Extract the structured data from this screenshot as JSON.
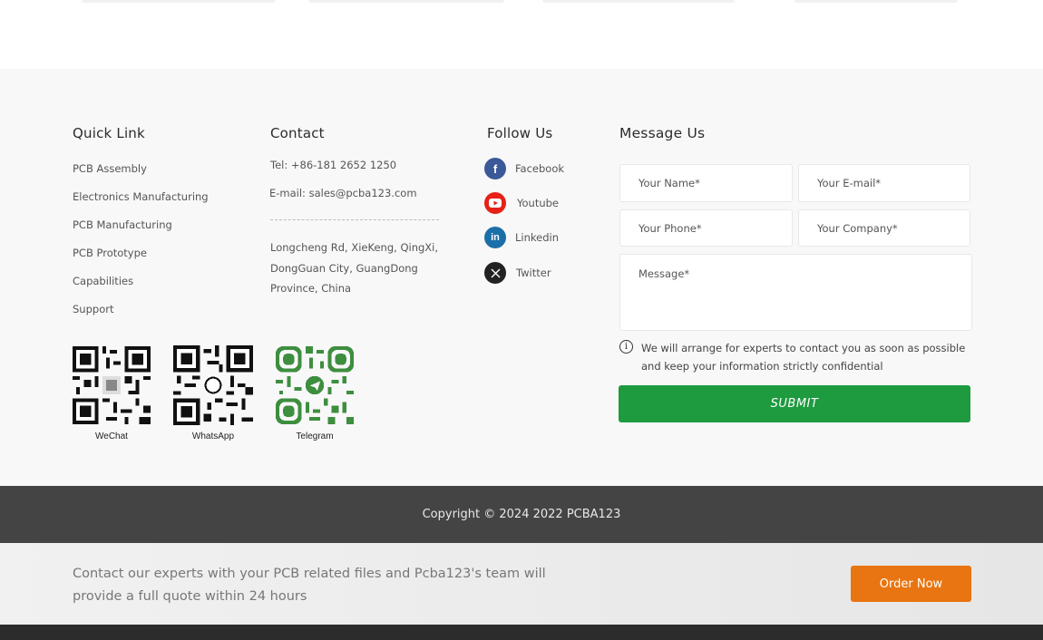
{
  "quick_link": {
    "title": "Quick Link",
    "items": [
      {
        "label": "PCB Assembly"
      },
      {
        "label": "Electronics Manufacturing"
      },
      {
        "label": "PCB Manufacturing"
      },
      {
        "label": "PCB Prototype"
      },
      {
        "label": "Capabilities"
      },
      {
        "label": "Support"
      }
    ]
  },
  "contact": {
    "title": "Contact",
    "tel": "Tel: +86-181 2652 1250",
    "email": "E-mail: sales@pcba123.com",
    "address": "Longcheng Rd, XieKeng, QingXi, DongGuan City, GuangDong Province, China"
  },
  "follow": {
    "title": "Follow Us",
    "items": [
      {
        "label": "Facebook",
        "icon": "facebook-icon",
        "color": "#3b5998"
      },
      {
        "label": "Youtube",
        "icon": "youtube-icon",
        "color": "#e62117"
      },
      {
        "label": "Linkedin",
        "icon": "linkedin-icon",
        "color": "#1b6fa8"
      },
      {
        "label": "Twitter",
        "icon": "x-twitter-icon",
        "color": "#222222"
      }
    ]
  },
  "qr_codes": [
    {
      "label": "WeChat",
      "color": "#111111"
    },
    {
      "label": "WhatsApp",
      "color": "#111111"
    },
    {
      "label": "Telegram",
      "color": "#3e8e3f"
    }
  ],
  "message": {
    "title": "Message Us",
    "name_placeholder": "Your Name*",
    "email_placeholder": "Your E-mail*",
    "phone_placeholder": "Your Phone*",
    "company_placeholder": "Your Company*",
    "message_placeholder": "Message*",
    "notice": "We will arrange for experts to contact you as soon as possible and keep your information strictly confidential",
    "submit_label": "SUBMIT",
    "submit_color": "#1e9a3f"
  },
  "copyright": "Copyright © 2024 2022 PCBA123",
  "cta": {
    "text": "Contact our experts with your PCB related files and Pcba123's team will provide a full quote within 24 hours",
    "button_label": "Order Now",
    "button_color": "#e87511"
  }
}
